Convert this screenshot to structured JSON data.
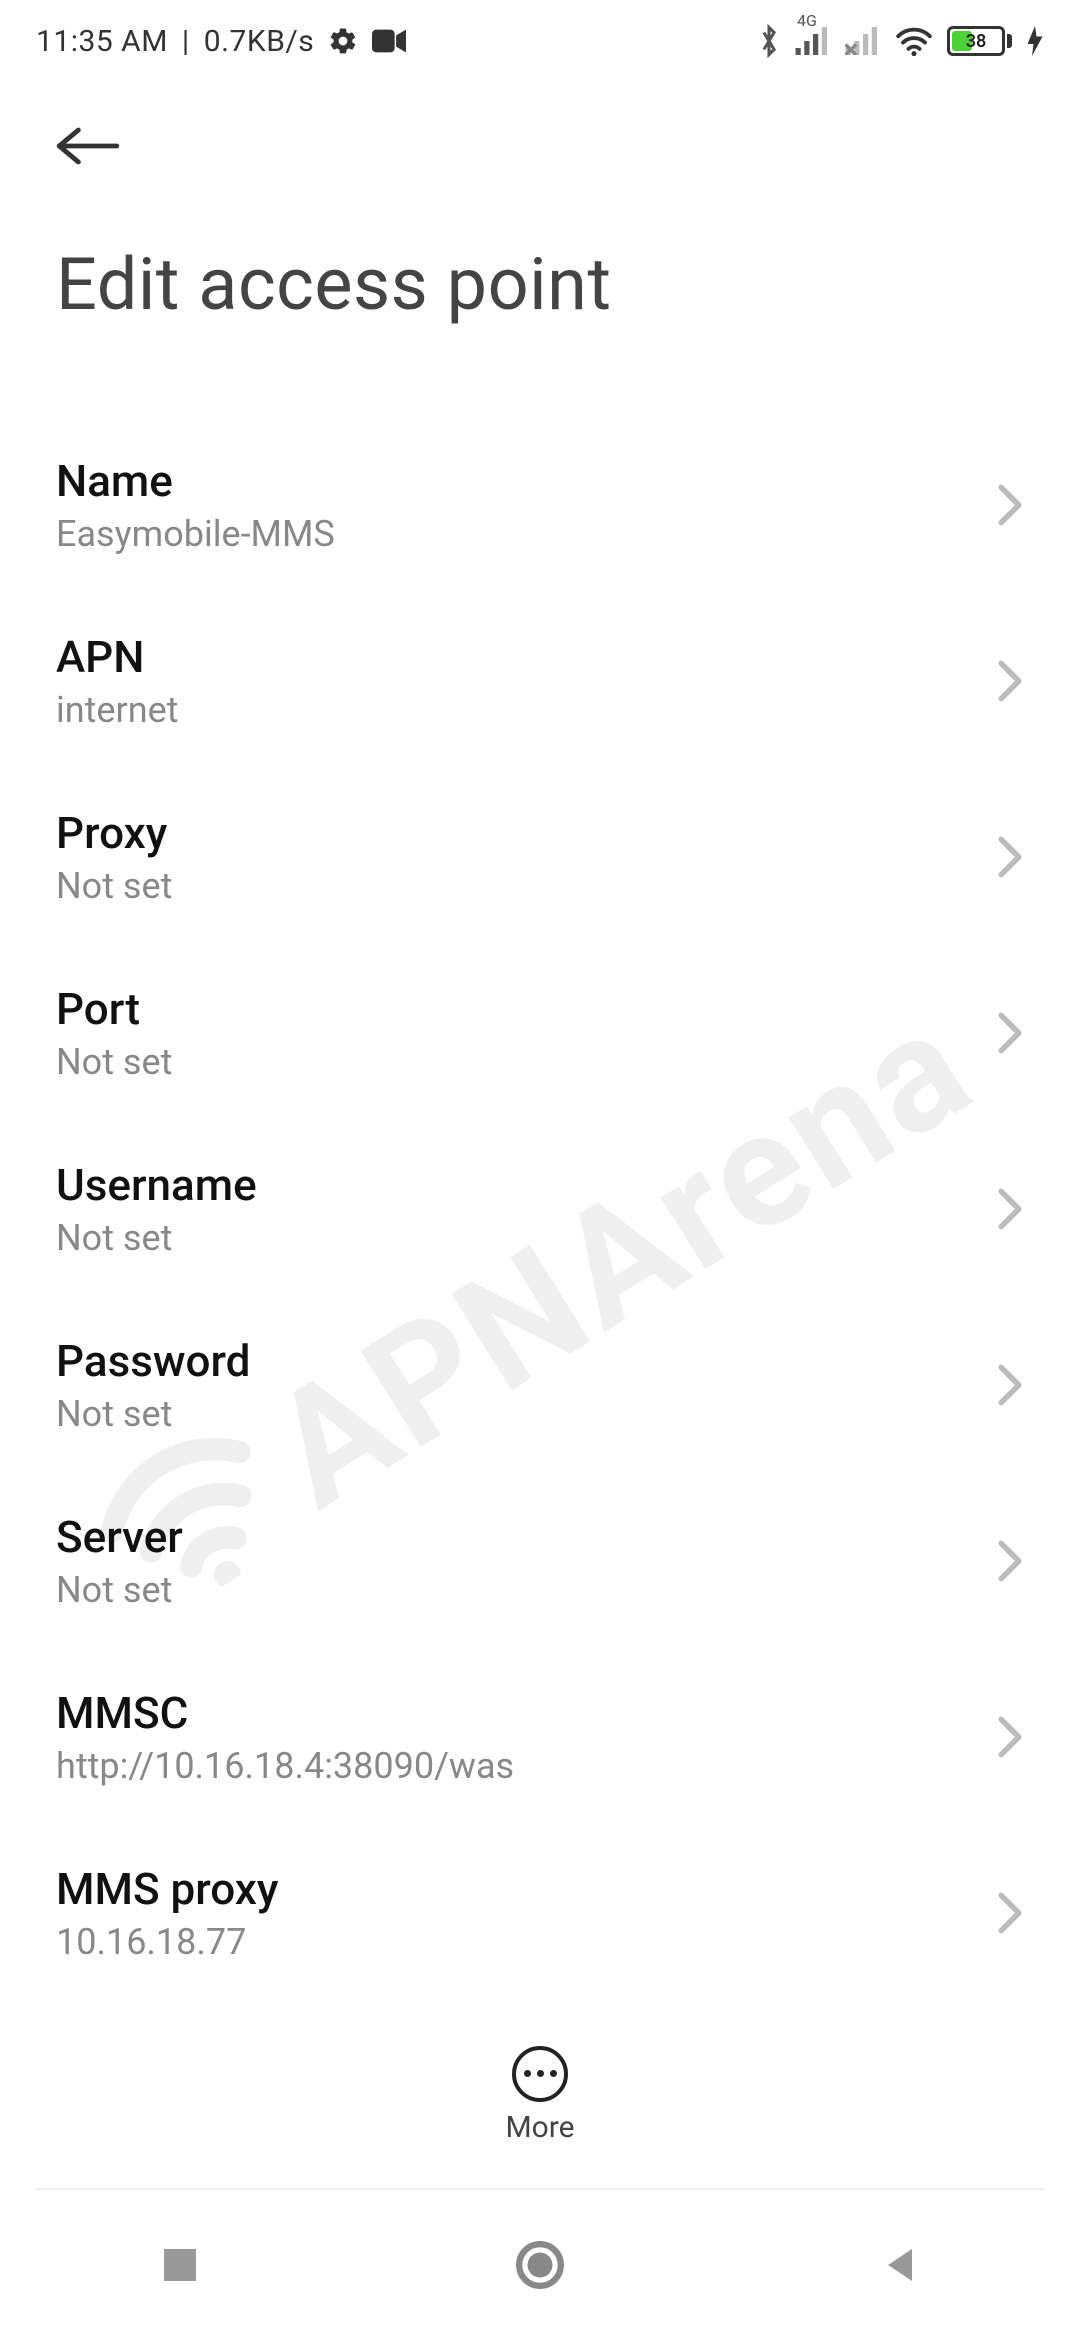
{
  "status": {
    "time": "11:35 AM",
    "sep": "|",
    "speed": "0.7KB/s",
    "network_label": "4G",
    "battery_pct": "38"
  },
  "header": {
    "title": "Edit access point"
  },
  "rows": [
    {
      "title": "Name",
      "value": "Easymobile-MMS"
    },
    {
      "title": "APN",
      "value": "internet"
    },
    {
      "title": "Proxy",
      "value": "Not set"
    },
    {
      "title": "Port",
      "value": "Not set"
    },
    {
      "title": "Username",
      "value": "Not set"
    },
    {
      "title": "Password",
      "value": "Not set"
    },
    {
      "title": "Server",
      "value": "Not set"
    },
    {
      "title": "MMSC",
      "value": "http://10.16.18.4:38090/was"
    },
    {
      "title": "MMS proxy",
      "value": "10.16.18.77"
    }
  ],
  "bottom": {
    "more": "More"
  },
  "watermark": "APNArena"
}
